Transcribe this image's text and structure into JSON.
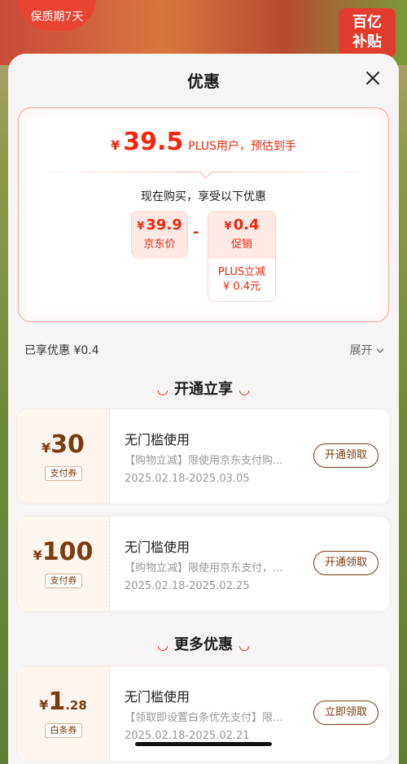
{
  "background": {
    "badge_left": "保质期7天",
    "badge_right_line1": "百亿",
    "badge_right_line2": "补贴"
  },
  "sheet": {
    "title": "优惠"
  },
  "price": {
    "yen": "¥",
    "value": "39.5",
    "suffix": "PLUS用户，预估到手",
    "current_buy": "现在购买，享受以下优惠",
    "jd_price": {
      "yen": "¥",
      "amount": "39.9",
      "label": "京东价"
    },
    "minus": "-",
    "promo": {
      "yen": "¥",
      "amount": "0.4",
      "label": "促销",
      "detail_line1": "PLUS立减",
      "detail_line2": "¥ 0.4元"
    }
  },
  "enjoyed": "已享优惠 ¥0.4",
  "expand": "展开",
  "sections": {
    "open": "开通立享",
    "more": "更多优惠"
  },
  "coupons": [
    {
      "yen": "¥",
      "amount": "30",
      "decimal": "",
      "tag": "支付券",
      "title": "无门槛使用",
      "desc": "【购物立减】限使用京东支付购...",
      "date": "2025.02.18-2025.03.05",
      "button": "开通领取"
    },
    {
      "yen": "¥",
      "amount": "100",
      "decimal": "",
      "tag": "支付券",
      "title": "无门槛使用",
      "desc": "【购物立减】限使用京东支付，...",
      "date": "2025.02.18-2025.02.25",
      "button": "开通领取"
    },
    {
      "yen": "¥",
      "amount": "1",
      "decimal": ".28",
      "tag": "白条券",
      "title": "无门槛使用",
      "desc": "【领取即设置白条优先支付】限...",
      "date": "2025.02.18-2025.02.21",
      "button": "立即领取"
    }
  ],
  "colors": {
    "accent": "#f2270c",
    "coupon_brown": "#7a3b10"
  }
}
